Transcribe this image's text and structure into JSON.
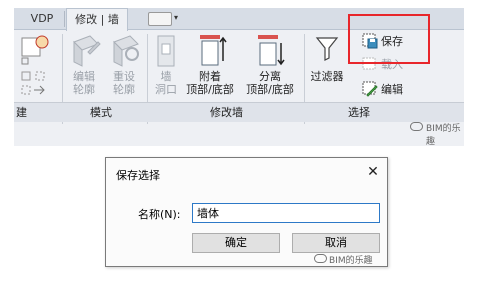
{
  "ribbon": {
    "tabs": [
      {
        "label": "VDP"
      },
      {
        "label": "修改 | 墙"
      }
    ],
    "panels": {
      "left_partial": {
        "label": "建"
      },
      "mode": {
        "label": "模式",
        "buttons": [
          {
            "line1": "编辑",
            "line2": "轮廓"
          },
          {
            "line1": "重设",
            "line2": "轮廓"
          }
        ]
      },
      "modify_wall": {
        "label": "修改墙",
        "buttons": [
          {
            "line1": "墙",
            "line2": "洞口"
          },
          {
            "line1": "附着",
            "line2": "顶部/底部"
          },
          {
            "line1": "分离",
            "line2": "顶部/底部"
          }
        ]
      },
      "selection": {
        "label": "选择",
        "filter_label": "过滤器",
        "save_label": "保存",
        "load_label": "载入",
        "edit_label": "编辑"
      }
    },
    "watermark": "BIM的乐趣"
  },
  "dialog": {
    "title": "保存选择",
    "name_label": "名称(N):",
    "name_value": "墙体",
    "ok_label": "确定",
    "cancel_label": "取消",
    "watermark": "BIM的乐趣"
  }
}
